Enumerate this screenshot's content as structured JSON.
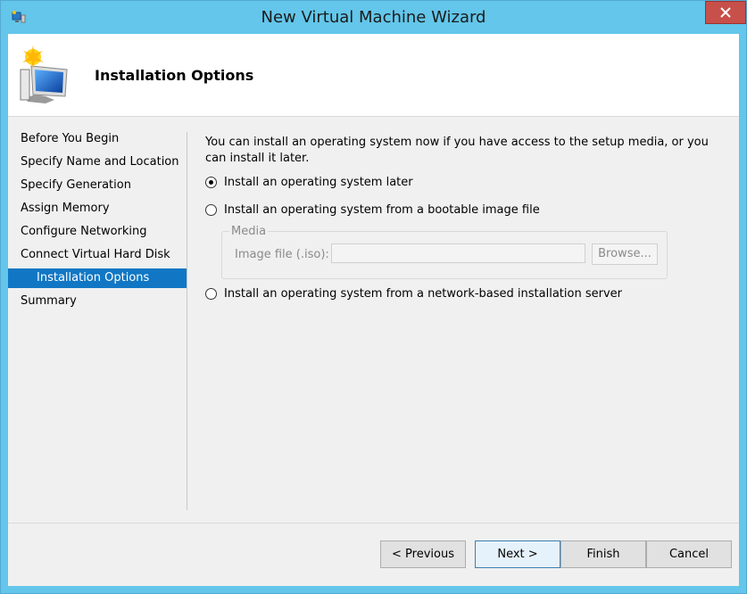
{
  "window": {
    "title": "New Virtual Machine Wizard"
  },
  "header": {
    "title": "Installation Options"
  },
  "nav": {
    "items": [
      {
        "label": "Before You Begin"
      },
      {
        "label": "Specify Name and Location"
      },
      {
        "label": "Specify Generation"
      },
      {
        "label": "Assign Memory"
      },
      {
        "label": "Configure Networking"
      },
      {
        "label": "Connect Virtual Hard Disk"
      },
      {
        "label": "Installation Options"
      },
      {
        "label": "Summary"
      }
    ],
    "selected": "Installation Options"
  },
  "content": {
    "description": "You can install an operating system now if you have access to the setup media, or you can install it later.",
    "options": [
      {
        "label": "Install an operating system later",
        "checked": true
      },
      {
        "label": "Install an operating system from a bootable image file",
        "checked": false
      },
      {
        "label": "Install an operating system from a network-based installation server",
        "checked": false
      }
    ],
    "media": {
      "legend": "Media",
      "image_label": "Image file (.iso):",
      "image_value": "",
      "browse_label": "Browse..."
    }
  },
  "buttons": {
    "previous": "< Previous",
    "next": "Next >",
    "finish": "Finish",
    "cancel": "Cancel"
  },
  "icons": {
    "app": "hyperv-app-icon",
    "header": "virtual-machine-icon",
    "close": "close-icon"
  }
}
